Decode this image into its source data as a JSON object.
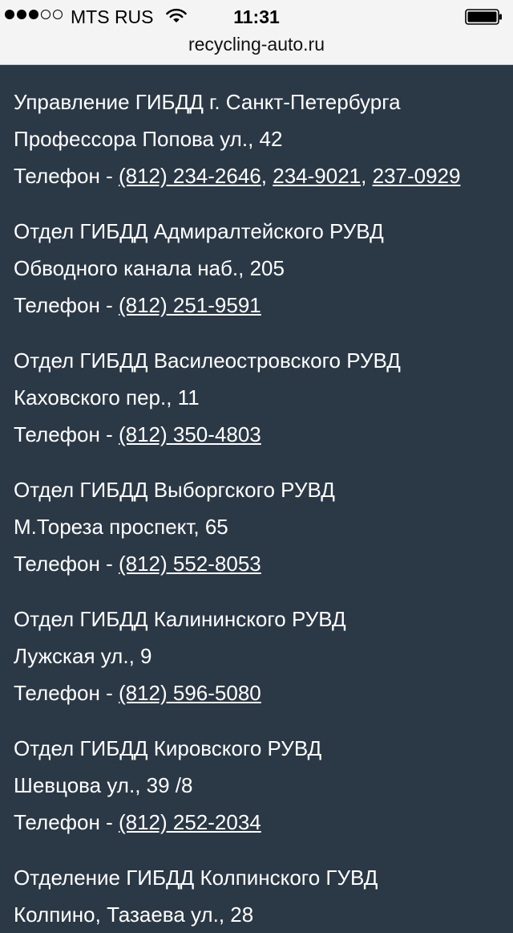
{
  "status_bar": {
    "carrier": "MTS RUS",
    "time": "11:31",
    "signal_bars": 3,
    "signal_total": 5
  },
  "browser": {
    "url": "recycling-auto.ru"
  },
  "phone_prefix": "Телефон - ",
  "entries": [
    {
      "name": "Управление ГИБДД г. Санкт-Петербурга",
      "address": "Профессора Попова ул., 42",
      "phones": [
        "(812) 234-2646",
        "234-9021",
        "237-0929"
      ]
    },
    {
      "name": "Отдел ГИБДД Адмиралтейского РУВД",
      "address": "Обводного канала наб., 205",
      "phones": [
        "(812) 251-9591"
      ]
    },
    {
      "name": "Отдел ГИБДД Василеостровского РУВД",
      "address": "Каховского пер., 11",
      "phones": [
        "(812) 350-4803"
      ]
    },
    {
      "name": "Отдел ГИБДД Выборгского РУВД",
      "address": "М.Тореза проспект, 65",
      "phones": [
        "(812) 552-8053"
      ]
    },
    {
      "name": "Отдел ГИБДД Калининского РУВД",
      "address": "Лужская ул., 9",
      "phones": [
        "(812) 596-5080"
      ]
    },
    {
      "name": "Отдел ГИБДД Кировского РУВД",
      "address": "Шевцова ул., 39 /8",
      "phones": [
        "(812) 252-2034"
      ]
    },
    {
      "name": "Отделение ГИБДД Колпинского ГУВД",
      "address": "Колпино, Тазаева ул., 28",
      "phones": []
    }
  ]
}
